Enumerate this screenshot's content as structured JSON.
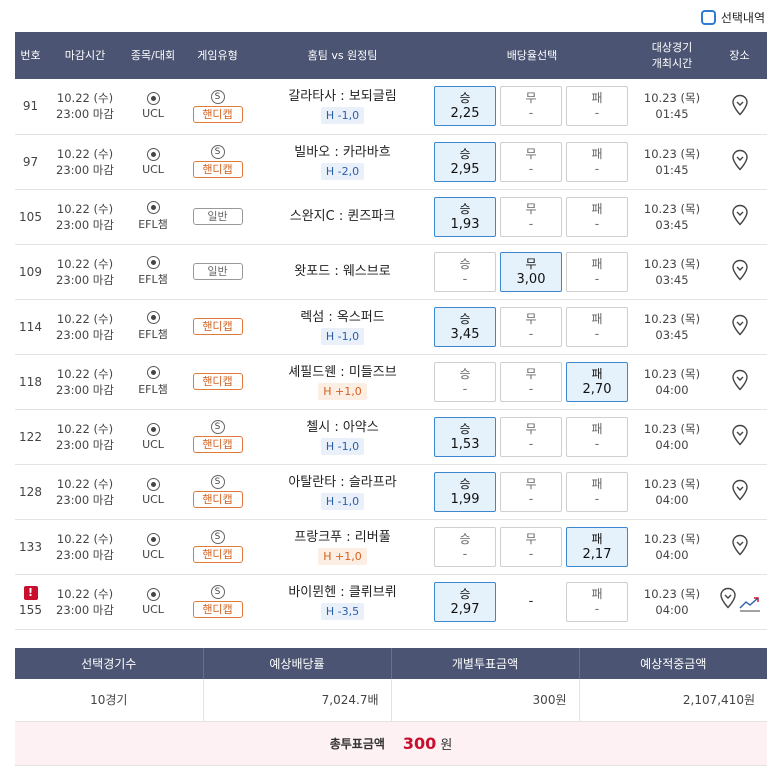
{
  "top": {
    "checkbox_label": "선택내역"
  },
  "headers": [
    "번호",
    "마감시간",
    "종목/대회",
    "게임유형",
    "홈팀 vs 원정팀",
    "배당율선택",
    "대상경기\n개최시간",
    "장소"
  ],
  "odds_labels": {
    "win": "승",
    "draw": "무",
    "lose": "패"
  },
  "rows": [
    {
      "no": "91",
      "deadline_date": "10.22 (수)",
      "deadline_time": "23:00 마감",
      "league": "UCL",
      "special": "S",
      "type": "핸디캡",
      "type_kind": "handi",
      "home": "갈라타사",
      "away": "보되글림",
      "handicap": "H -1,0",
      "hc_kind": "neg",
      "win": "2,25",
      "draw": "-",
      "lose": "-",
      "selected": "win",
      "draw_disabled": false,
      "event_date": "10.23 (목)",
      "event_time": "01:45",
      "warning": "",
      "trend": false
    },
    {
      "no": "97",
      "deadline_date": "10.22 (수)",
      "deadline_time": "23:00 마감",
      "league": "UCL",
      "special": "S",
      "type": "핸디캡",
      "type_kind": "handi",
      "home": "빌바오",
      "away": "카라바흐",
      "handicap": "H -2,0",
      "hc_kind": "neg",
      "win": "2,95",
      "draw": "-",
      "lose": "-",
      "selected": "win",
      "draw_disabled": false,
      "event_date": "10.23 (목)",
      "event_time": "01:45",
      "warning": "",
      "trend": false
    },
    {
      "no": "105",
      "deadline_date": "10.22 (수)",
      "deadline_time": "23:00 마감",
      "league": "EFL챔",
      "special": "",
      "type": "일반",
      "type_kind": "normal",
      "home": "스완지C",
      "away": "퀸즈파크",
      "handicap": "",
      "hc_kind": "",
      "win": "1,93",
      "draw": "-",
      "lose": "-",
      "selected": "win",
      "draw_disabled": false,
      "event_date": "10.23 (목)",
      "event_time": "03:45",
      "warning": "",
      "trend": false
    },
    {
      "no": "109",
      "deadline_date": "10.22 (수)",
      "deadline_time": "23:00 마감",
      "league": "EFL챔",
      "special": "",
      "type": "일반",
      "type_kind": "normal",
      "home": "왓포드",
      "away": "웨스브로",
      "handicap": "",
      "hc_kind": "",
      "win": "-",
      "draw": "3,00",
      "lose": "-",
      "selected": "draw",
      "draw_disabled": false,
      "event_date": "10.23 (목)",
      "event_time": "03:45",
      "warning": "",
      "trend": false
    },
    {
      "no": "114",
      "deadline_date": "10.22 (수)",
      "deadline_time": "23:00 마감",
      "league": "EFL챔",
      "special": "",
      "type": "핸디캡",
      "type_kind": "handi",
      "home": "렉섬",
      "away": "옥스퍼드",
      "handicap": "H -1,0",
      "hc_kind": "neg",
      "win": "3,45",
      "draw": "-",
      "lose": "-",
      "selected": "win",
      "draw_disabled": false,
      "event_date": "10.23 (목)",
      "event_time": "03:45",
      "warning": "",
      "trend": false
    },
    {
      "no": "118",
      "deadline_date": "10.22 (수)",
      "deadline_time": "23:00 마감",
      "league": "EFL챔",
      "special": "",
      "type": "핸디캡",
      "type_kind": "handi",
      "home": "셰필드웬",
      "away": "미들즈브",
      "handicap": "H +1,0",
      "hc_kind": "pos",
      "win": "-",
      "draw": "-",
      "lose": "2,70",
      "selected": "lose",
      "draw_disabled": false,
      "event_date": "10.23 (목)",
      "event_time": "04:00",
      "warning": "",
      "trend": false
    },
    {
      "no": "122",
      "deadline_date": "10.22 (수)",
      "deadline_time": "23:00 마감",
      "league": "UCL",
      "special": "S",
      "type": "핸디캡",
      "type_kind": "handi",
      "home": "첼시",
      "away": "아약스",
      "handicap": "H -1,0",
      "hc_kind": "neg",
      "win": "1,53",
      "draw": "-",
      "lose": "-",
      "selected": "win",
      "draw_disabled": false,
      "event_date": "10.23 (목)",
      "event_time": "04:00",
      "warning": "",
      "trend": false
    },
    {
      "no": "128",
      "deadline_date": "10.22 (수)",
      "deadline_time": "23:00 마감",
      "league": "UCL",
      "special": "S",
      "type": "핸디캡",
      "type_kind": "handi",
      "home": "아탈란타",
      "away": "슬라프라",
      "handicap": "H -1,0",
      "hc_kind": "neg",
      "win": "1,99",
      "draw": "-",
      "lose": "-",
      "selected": "win",
      "draw_disabled": false,
      "event_date": "10.23 (목)",
      "event_time": "04:00",
      "warning": "",
      "trend": false
    },
    {
      "no": "133",
      "deadline_date": "10.22 (수)",
      "deadline_time": "23:00 마감",
      "league": "UCL",
      "special": "S",
      "type": "핸디캡",
      "type_kind": "handi",
      "home": "프랑크푸",
      "away": "리버풀",
      "handicap": "H +1,0",
      "hc_kind": "pos",
      "win": "-",
      "draw": "-",
      "lose": "2,17",
      "selected": "lose",
      "draw_disabled": false,
      "event_date": "10.23 (목)",
      "event_time": "04:00",
      "warning": "",
      "trend": false
    },
    {
      "no": "155",
      "deadline_date": "10.22 (수)",
      "deadline_time": "23:00 마감",
      "league": "UCL",
      "special": "S",
      "type": "핸디캡",
      "type_kind": "handi",
      "home": "바이뮌헨",
      "away": "클뤼브뤼",
      "handicap": "H -3,5",
      "hc_kind": "neg",
      "win": "2,97",
      "draw": "-",
      "lose": "-",
      "selected": "win",
      "draw_disabled": true,
      "event_date": "10.23 (목)",
      "event_time": "04:00",
      "warning": "!",
      "trend": true
    }
  ],
  "summary": {
    "headers": [
      "선택경기수",
      "예상배당률",
      "개별투표금액",
      "예상적중금액"
    ],
    "values": [
      "10경기",
      "7,024.7배",
      "300원",
      "2,107,410원"
    ],
    "total_label": "총투표금액",
    "total_value": "300",
    "total_unit": "원"
  }
}
